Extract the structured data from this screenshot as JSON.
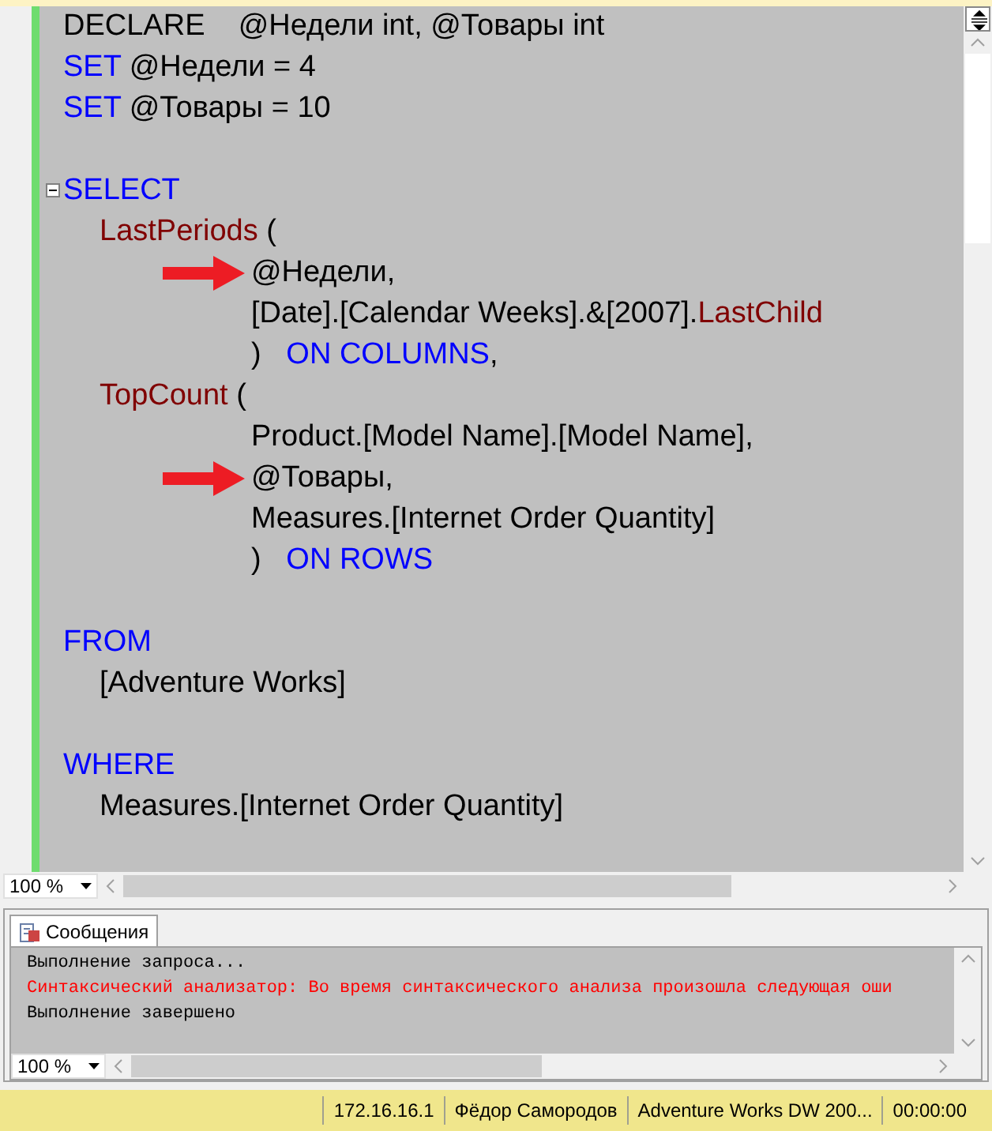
{
  "editor": {
    "statements": [
      {
        "lines": [
          {
            "tokens": [
              {
                "text": "DECLARE    @Недели int, @Товары int",
                "kind": "plain"
              }
            ]
          },
          {
            "tokens": [
              {
                "text": "SET",
                "kind": "keyword"
              },
              {
                "text": " @Недели = 4",
                "kind": "plain"
              }
            ]
          },
          {
            "tokens": [
              {
                "text": "SET",
                "kind": "keyword"
              },
              {
                "text": " @Товары = 10",
                "kind": "plain"
              }
            ]
          }
        ]
      },
      {
        "lines": [
          {
            "expanded": true,
            "tokens": [
              {
                "text": "SELECT",
                "kind": "keyword"
              }
            ],
            "children": [
              {
                "tokens": [
                  {
                    "text": "LastPeriods",
                    "kind": "function"
                  },
                  {
                    "text": " (",
                    "kind": "plain"
                  }
                ],
                "children": [
                  {
                    "marked": true,
                    "tokens": [
                      {
                        "text": "@Недели,",
                        "kind": "plain"
                      }
                    ]
                  },
                  {
                    "tokens": [
                      {
                        "text": "[Date].[Calendar Weeks].&[2007].",
                        "kind": "plain"
                      },
                      {
                        "text": "LastChild",
                        "kind": "function"
                      }
                    ]
                  },
                  {
                    "tokens": [
                      {
                        "text": ")   ",
                        "kind": "plain"
                      },
                      {
                        "text": "ON COLUMNS",
                        "kind": "keyword"
                      },
                      {
                        "text": ",",
                        "kind": "plain"
                      }
                    ]
                  }
                ]
              },
              {
                "tokens": [
                  {
                    "text": "TopCount",
                    "kind": "function"
                  },
                  {
                    "text": " (",
                    "kind": "plain"
                  }
                ],
                "children": [
                  {
                    "tokens": [
                      {
                        "text": "Product.[Model Name].[Model Name],",
                        "kind": "plain"
                      }
                    ]
                  },
                  {
                    "marked": true,
                    "tokens": [
                      {
                        "text": "@Товары,",
                        "kind": "plain"
                      }
                    ]
                  },
                  {
                    "tokens": [
                      {
                        "text": "Measures.[Internet Order Quantity]",
                        "kind": "plain"
                      }
                    ]
                  },
                  {
                    "tokens": [
                      {
                        "text": ")   ",
                        "kind": "plain"
                      },
                      {
                        "text": "ON ROWS",
                        "kind": "keyword"
                      }
                    ]
                  }
                ]
              }
            ]
          }
        ]
      },
      {
        "lines": [
          {
            "tokens": [
              {
                "text": "FROM",
                "kind": "keyword"
              }
            ],
            "children": [
              {
                "tokens": [
                  {
                    "text": "[Adventure Works]",
                    "kind": "plain"
                  }
                ]
              }
            ]
          }
        ]
      },
      {
        "lines": [
          {
            "tokens": [
              {
                "text": "WHERE",
                "kind": "keyword"
              }
            ],
            "children": [
              {
                "tokens": [
                  {
                    "text": "Measures.[Internet Order Quantity]",
                    "kind": "plain"
                  }
                ]
              }
            ]
          }
        ]
      }
    ],
    "zoom": "100 %"
  },
  "results": {
    "tabs": [
      {
        "label": "Сообщения",
        "selected": true
      }
    ],
    "messages": [
      {
        "text": "Выполнение запроса...",
        "kind": "info"
      },
      {
        "text": "Синтаксический анализатор: Во время синтаксического анализа произошла следующая оши",
        "kind": "error"
      },
      {
        "text": "Выполнение завершено",
        "kind": "info"
      }
    ],
    "zoom": "100 %"
  },
  "status_bar": [
    "172.16.16.1",
    "Фёдор Самородов",
    "Adventure Works DW 200...",
    "00:00:00"
  ]
}
